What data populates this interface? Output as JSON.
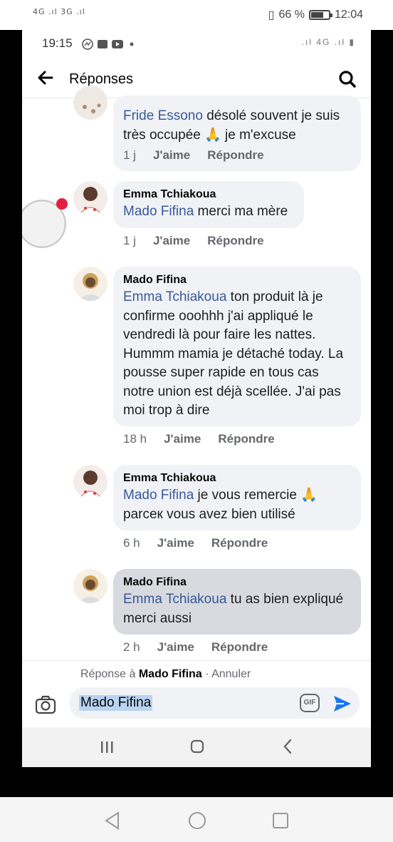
{
  "outer_status": {
    "network_left": "4G .ıl 3G .ıl",
    "battery": "66 %",
    "time": "12:04"
  },
  "inner_status": {
    "time": "19:15",
    "network_right": "4G"
  },
  "header": {
    "title": "Réponses",
    "back_icon": "arrow-left-icon",
    "search_icon": "search-icon"
  },
  "comments": [
    {
      "author": "",
      "mention": "Fride Essono",
      "text": " désolé souvent je suis très occupée 🙏 je m'excuse",
      "age": "1 j",
      "like": "J'aime",
      "reply": "Répondre"
    },
    {
      "author": "Emma Tchiakoua",
      "mention": "Mado Fifina",
      "text": " merci ma mère",
      "age": "1 j",
      "like": "J'aime",
      "reply": "Répondre"
    },
    {
      "author": "Mado Fifina",
      "mention": "Emma Tchiakoua",
      "text": " ton produit là je confirme ooohhh j'ai appliqué le vendredi là pour faire les nattes. Hummm mamia je détaché today. La pousse super rapide en tous cas notre union est déjà scellée. J'ai pas moi trop à dire",
      "age": "18 h",
      "like": "J'aime",
      "reply": "Répondre"
    },
    {
      "author": "Emma Tchiakoua",
      "mention": "Mado Fifina",
      "text": " je vous remercie 🙏 parceк vous avez bien utilisé",
      "age": "6 h",
      "like": "J'aime",
      "reply": "Répondre"
    },
    {
      "author": "Mado Fifina",
      "mention": "Emma Tchiakoua",
      "text": " tu as bien expliqué merci aussi",
      "age": "2 h",
      "like": "J'aime",
      "reply": "Répondre"
    }
  ],
  "reply_bar": {
    "prefix": "Réponse à",
    "name": "Mado Fifina",
    "cancel": "· Annuler"
  },
  "composer": {
    "value": "Mado Fifina",
    "gif_label": "GIF"
  },
  "colors": {
    "link": "#385898",
    "bubble": "#f0f2f5",
    "send": "#1877f2"
  }
}
